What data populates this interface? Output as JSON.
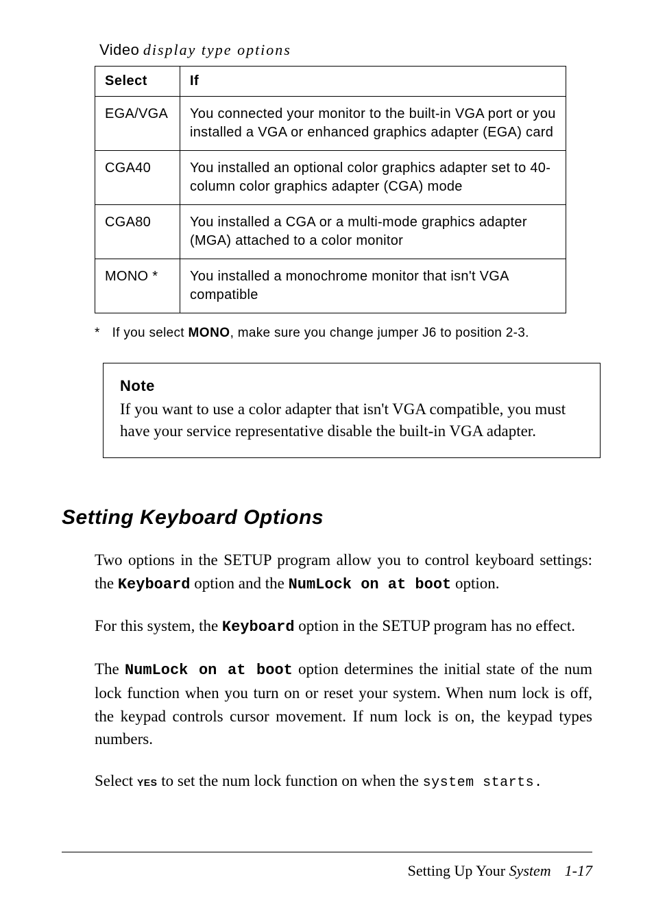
{
  "table_caption": {
    "prefix": "Video",
    "rest": "display type options"
  },
  "table": {
    "headers": {
      "col1": "Select",
      "col2": "If"
    },
    "rows": [
      {
        "select": "EGA/VGA",
        "desc": "You connected your monitor to the built-in VGA port or you installed a VGA or enhanced graphics adapter (EGA) card"
      },
      {
        "select": "CGA40",
        "desc": "You installed an optional color graphics adapter set to 40-column color graphics adapter (CGA) mode"
      },
      {
        "select": "CGA80",
        "desc": "You installed a CGA or a multi-mode graphics adapter (MGA) attached to a color monitor"
      },
      {
        "select": "MONO *",
        "desc": "You installed a monochrome monitor that isn't VGA compatible"
      }
    ]
  },
  "footnote": {
    "star": "*",
    "before": "If you select ",
    "mono": "MONO",
    "after": ", make sure you change jumper J6 to position 2-3."
  },
  "note": {
    "title": "Note",
    "body": "If you want to use a color adapter that isn't VGA compatible, you must have your service representative disable the built-in VGA adapter."
  },
  "section_heading": "Setting Keyboard Options",
  "para1": {
    "t1": "Two options in the SETUP program allow you to control keyboard settings: the ",
    "kw1": "Keyboard",
    "t2": " option and the ",
    "kw2": "NumLock on at boot",
    "t3": " option."
  },
  "para2": {
    "t1": "For this system, the ",
    "kw1": "Keyboard",
    "t2": " option in the SETUP program has no effect."
  },
  "para3": {
    "t1": "The ",
    "kw1": "NumLock on at boot",
    "t2": " option determines the initial state of the num lock function when you turn on or reset your system. When num lock is off, the keypad controls cursor movement. If num lock is on, the keypad types numbers."
  },
  "para4": {
    "t1": "Select ",
    "yes": "YES",
    "t2": " to set the num lock function on when the ",
    "end": "system starts."
  },
  "footer": {
    "text": "Setting Up Your ",
    "italic": "System",
    "page": "1-17"
  }
}
